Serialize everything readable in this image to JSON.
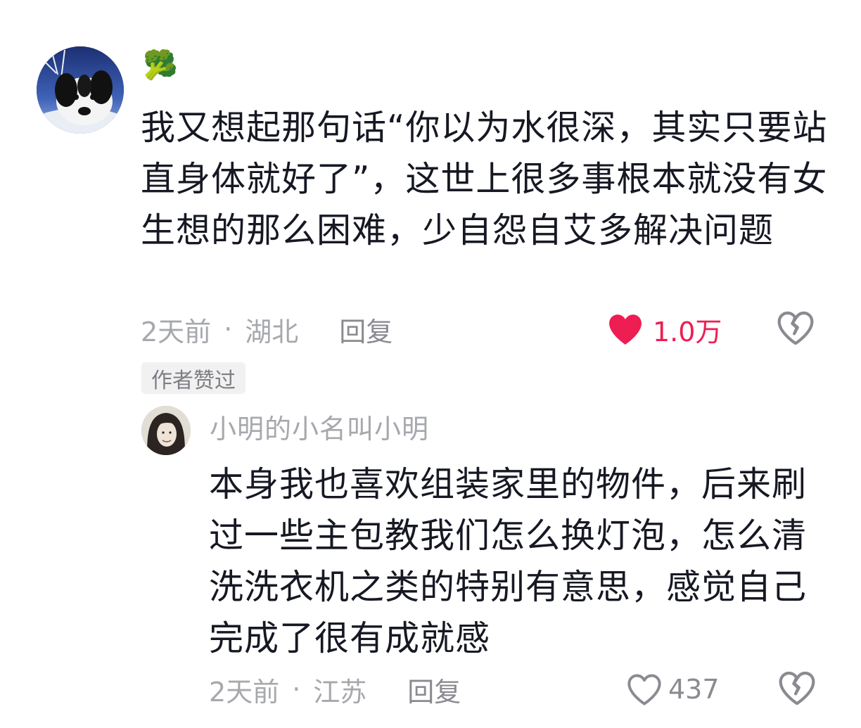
{
  "main_comment": {
    "username_emoji": "🥦",
    "text": "我又想起那句话“你以为水很深，其实只要站直身体就好了”，这世上很多事根本就没有女生想的那么困难，少自怨自艾多解决问题",
    "time": "2天前",
    "separator": "·",
    "location": "湖北",
    "reply_label": "回复",
    "like_count": "1.0万",
    "liked": true,
    "author_badge": "作者赞过"
  },
  "reply_comment": {
    "username": "小明的小名叫小明",
    "text": "本身我也喜欢组装家里的物件，后来刷过一些主包教我们怎么换灯泡，怎么清洗洗衣机之类的特别有意思，感觉自己完成了很有成就感",
    "time": "2天前",
    "separator": "·",
    "location": "江苏",
    "reply_label": "回复",
    "like_count": "437",
    "liked": false
  },
  "icons": {
    "like_filled": "heart-icon",
    "like_outline": "heart-outline-icon",
    "dislike": "broken-heart-icon"
  },
  "colors": {
    "like_active": "#ee1d52",
    "meta_text": "#a7a8ad",
    "body_text": "#161823",
    "badge_bg": "#f1f1f2"
  }
}
